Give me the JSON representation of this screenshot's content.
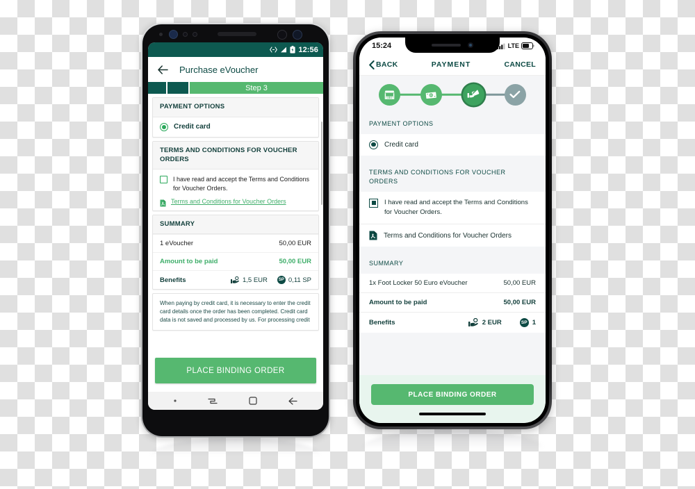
{
  "android": {
    "status_bar": {
      "time": "12:56",
      "icons": [
        "usb-debug-icon",
        "signal-icon",
        "battery-icon"
      ]
    },
    "app_bar": {
      "back_icon": "arrow-left-icon",
      "title": "Purchase eVoucher"
    },
    "stepper": {
      "current_label": "Step 3",
      "completed_steps": 2,
      "total_steps": 3
    },
    "payment_options": {
      "header": "PAYMENT OPTIONS",
      "selected": "Credit card"
    },
    "terms": {
      "header": "TERMS AND CONDITIONS FOR VOUCHER ORDERS",
      "checkbox_label": "I have read and accept the Terms and Conditions for Voucher Orders.",
      "pdf_link": "Terms and Conditions for Voucher Orders",
      "checked": false
    },
    "summary": {
      "header": "SUMMARY",
      "line_item_label": "1 eVoucher",
      "line_item_value": "50,00 EUR",
      "total_label": "Amount to be paid",
      "total_value": "50,00 EUR",
      "benefits_label": "Benefits",
      "benefit_cash": "1,5 EUR",
      "benefit_points": "0,11 SP",
      "sp_badge": "SP"
    },
    "disclaimer": "When paying by credit card, it is necessary to enter the credit card details once the order has been completed. Credit card data is not saved and processed by us. For processing credit",
    "cta_label": "PLACE BINDING ORDER",
    "nav_bar": {
      "recents_icon": "recents-icon",
      "home_icon": "home-square-icon",
      "back_icon": "arrow-left-icon"
    }
  },
  "iphone": {
    "status_bar": {
      "time": "15:24",
      "carrier": "LTE",
      "icons": [
        "cellular-signal-icon",
        "battery-icon"
      ]
    },
    "nav_bar": {
      "back_label": "BACK",
      "title": "PAYMENT",
      "cancel_label": "CANCEL"
    },
    "stepper": {
      "steps": [
        {
          "name": "store-step",
          "icon": "store-icon",
          "state": "done"
        },
        {
          "name": "amount-step",
          "icon": "banknote-icon",
          "state": "done"
        },
        {
          "name": "payment-step",
          "icon": "card-hand-icon",
          "state": "current"
        },
        {
          "name": "confirm-step",
          "icon": "check-icon",
          "state": "pending"
        }
      ]
    },
    "payment_options": {
      "header": "PAYMENT OPTIONS",
      "selected": "Credit card"
    },
    "terms": {
      "header": "TERMS AND CONDITIONS FOR VOUCHER ORDERS",
      "checkbox_label": "I have read and accept the Terms and Conditions for Voucher Orders.",
      "pdf_link": "Terms and Conditions for Voucher Orders",
      "checked": true
    },
    "summary": {
      "header": "SUMMARY",
      "line_item_label": "1x  Foot Locker 50 Euro eVoucher",
      "line_item_value": "50,00 EUR",
      "total_label": "Amount to be paid",
      "total_value": "50,00 EUR",
      "benefits_label": "Benefits",
      "benefit_cash": "2 EUR",
      "benefit_points": "1",
      "sp_badge": "SP"
    },
    "cta_label": "PLACE BINDING ORDER"
  },
  "colors": {
    "brand_dark_teal": "#0d4a44",
    "brand_status_bar": "#0d5950",
    "accent_green": "#56b870",
    "link_green": "#3fae6a",
    "step_pending_gray": "#8ba3a6",
    "panel_gray": "#f4f5f7"
  }
}
